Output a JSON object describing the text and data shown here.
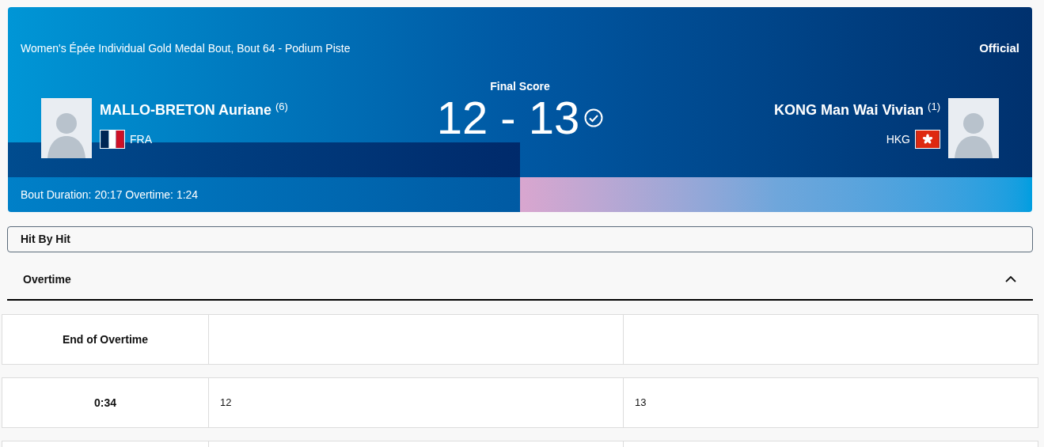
{
  "header": {
    "event": "Women's Épée Individual Gold Medal Bout, Bout 64 - Podium Piste",
    "status": "Official",
    "score_label": "Final Score",
    "score": "12 - 13",
    "duration": "Bout Duration: 20:17 Overtime: 1:24"
  },
  "fencers": [
    {
      "name": "MALLO-BRETON Auriane",
      "seed": "(6)",
      "country": "FRA",
      "flag": {
        "kind": "fra"
      }
    },
    {
      "name": "KONG Man Wai Vivian",
      "seed": "(1)",
      "country": "HKG",
      "flag": {
        "kind": "hkg"
      }
    }
  ],
  "hit_by_hit": {
    "label": "Hit By Hit"
  },
  "section": {
    "title": "Overtime",
    "expanded": true
  },
  "rows": [
    {
      "time": "End of Overtime"
    },
    {
      "time": "0:34",
      "fencer_1": "12",
      "fencer_2": "13"
    },
    {}
  ]
}
